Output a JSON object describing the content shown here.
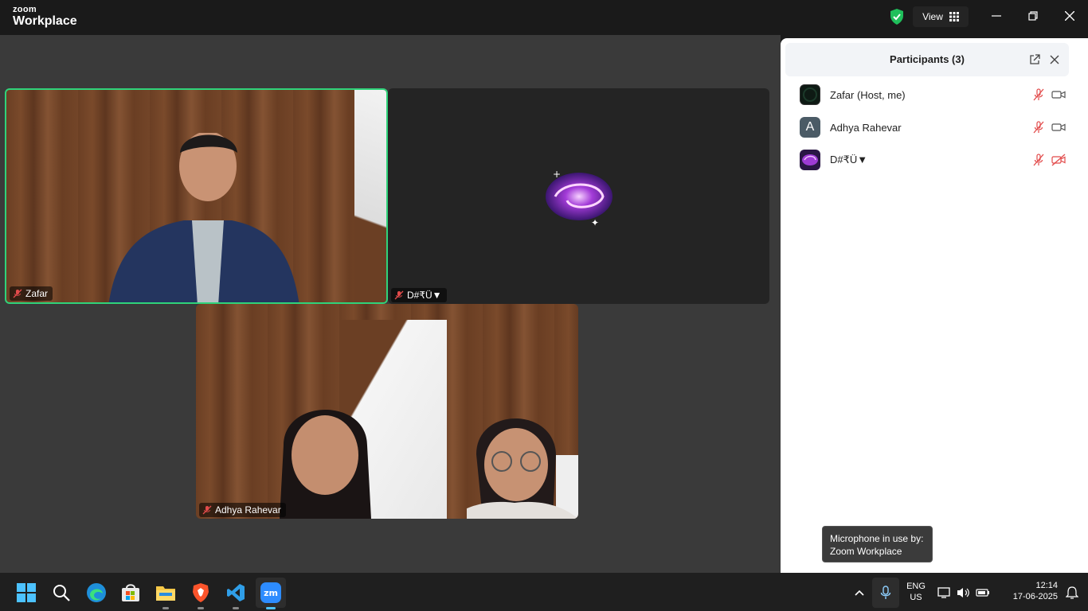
{
  "titlebar": {
    "logo_top": "zoom",
    "logo_bottom": "Workplace",
    "view_label": "View"
  },
  "tiles": {
    "zafar": "Zafar",
    "third": "D#₹Ü▼",
    "adhya": "Adhya Rahevar"
  },
  "panel": {
    "title": "Participants (3)",
    "participants": [
      {
        "name": "Zafar (Host, me)",
        "avatar_letter": "",
        "video_on": true
      },
      {
        "name": "Adhya Rahevar",
        "avatar_letter": "A",
        "video_on": true
      },
      {
        "name": "D#₹Ü▼",
        "avatar_letter": "",
        "video_on": false
      }
    ]
  },
  "tooltip": {
    "line1": "Microphone in use by:",
    "line2": "Zoom Workplace"
  },
  "taskbar": {
    "lang_top": "ENG",
    "lang_bottom": "US",
    "time": "12:14",
    "date": "17-06-2025"
  },
  "colors": {
    "active_speaker": "#2fd37a",
    "mute_red": "#e24b4b",
    "shield_green": "#1fbf5b",
    "zoom_blue": "#2d8cff"
  }
}
